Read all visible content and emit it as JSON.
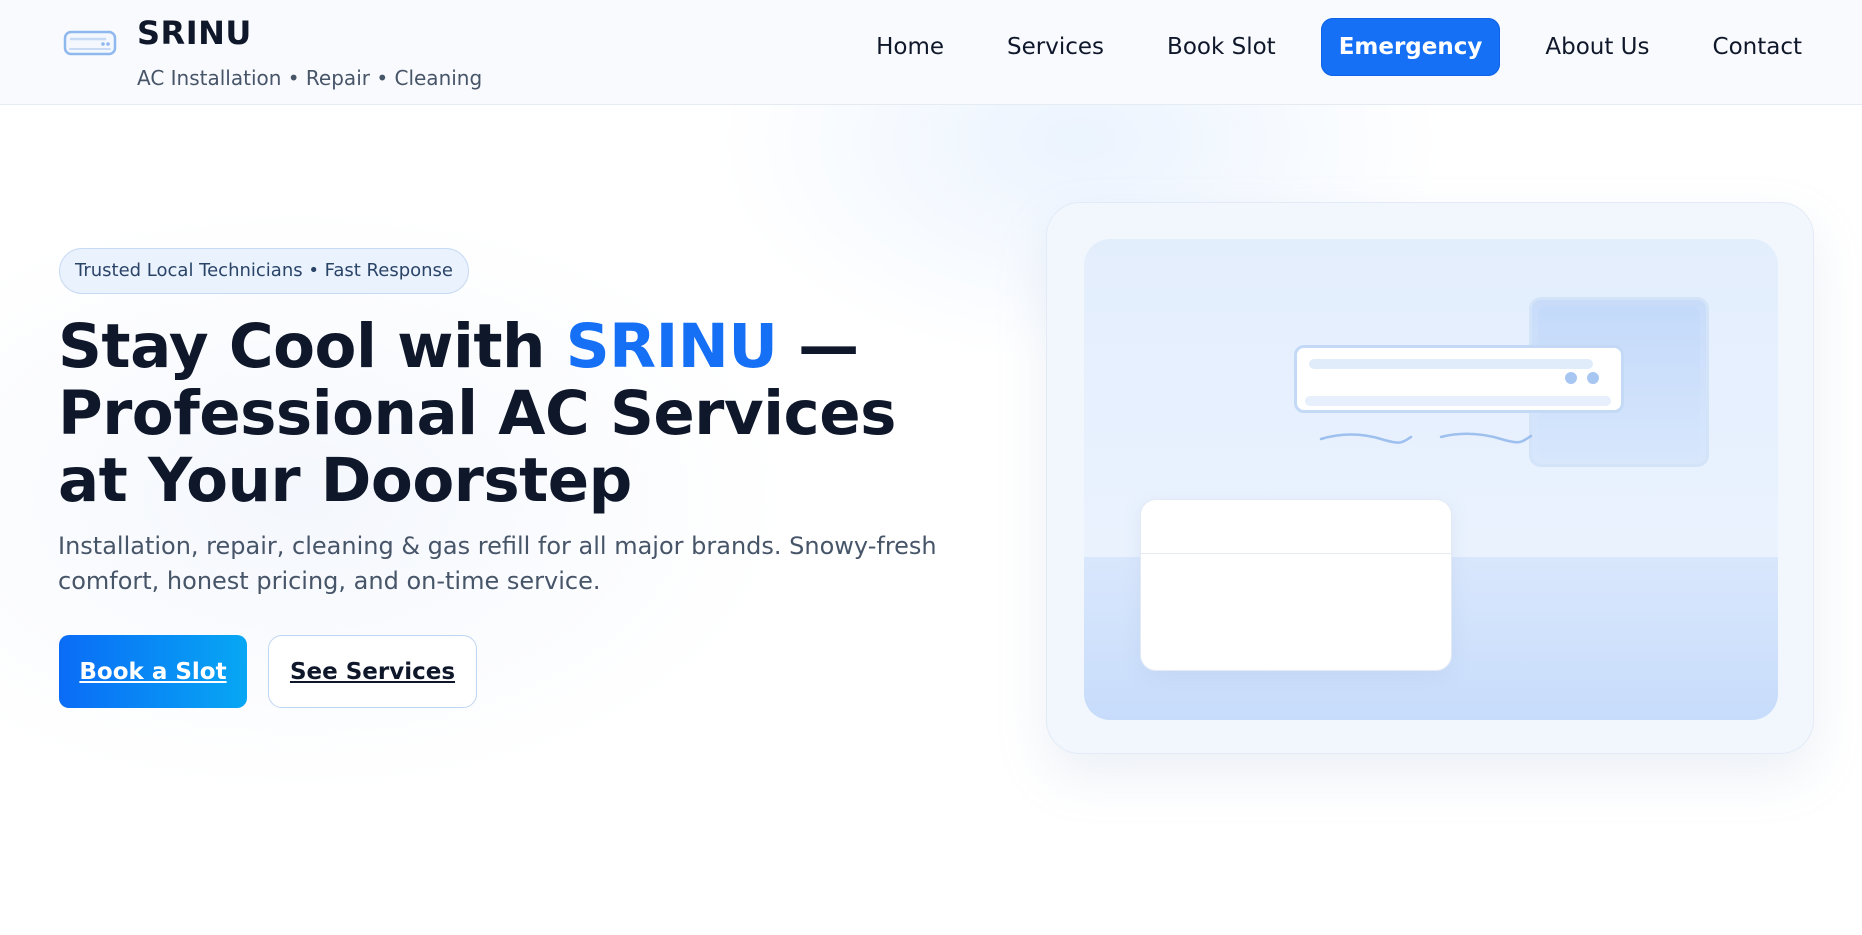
{
  "brand": {
    "name": "SRINU",
    "tagline": "AC Installation • Repair • Cleaning",
    "logo_icon": "ac-unit-icon"
  },
  "nav": {
    "items": [
      {
        "label": "Home"
      },
      {
        "label": "Services"
      },
      {
        "label": "Book Slot"
      },
      {
        "label": "Emergency",
        "highlighted": true
      },
      {
        "label": "About Us"
      },
      {
        "label": "Contact"
      }
    ]
  },
  "hero": {
    "badge": "Trusted Local Technicians • Fast Response",
    "title_before": "Stay Cool with ",
    "title_accent": "SRINU",
    "title_after": " — Professional AC Services at Your Doorstep",
    "subtitle": "Installation, repair, cleaning & gas refill for all major brands. Snowy-fresh comfort, honest pricing, and on-time service.",
    "primary_cta": "Book a Slot",
    "secondary_cta": "See Services"
  },
  "colors": {
    "accent": "#1570f5",
    "heading": "#0f172a",
    "muted": "#475569",
    "cta_gradient_start": "#0a6cf6",
    "cta_gradient_end": "#07a7f4"
  },
  "illustration": {
    "icons": [
      "air-conditioner-icon",
      "window-icon",
      "sofa-icon",
      "airflow-icon"
    ]
  }
}
